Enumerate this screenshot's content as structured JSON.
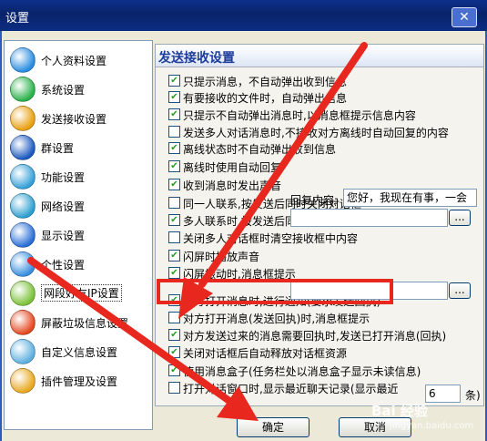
{
  "window": {
    "title": "设置",
    "close_glyph": "✕"
  },
  "sidebar": {
    "items": [
      {
        "label": "个人资料设置",
        "icon": "globe-icon",
        "color": "#2a8de0"
      },
      {
        "label": "系统设置",
        "icon": "gear-icon",
        "color": "#2bb24a"
      },
      {
        "label": "发送接收设置",
        "icon": "send-receive-icon",
        "color": "#e8a010"
      },
      {
        "label": "群设置",
        "icon": "group-icon",
        "color": "#1d5ac0"
      },
      {
        "label": "功能设置",
        "icon": "function-icon",
        "color": "#36a0d8"
      },
      {
        "label": "网络设置",
        "icon": "network-icon",
        "color": "#2f9fd0"
      },
      {
        "label": "显示设置",
        "icon": "display-icon",
        "color": "#2b6fd6"
      },
      {
        "label": "个性设置",
        "icon": "personalize-icon",
        "color": "#3a8fe0"
      },
      {
        "label": "网段好友IP设置",
        "icon": "ip-icon",
        "color": "#7cc23a"
      },
      {
        "label": "屏蔽垃圾信息设置",
        "icon": "block-spam-icon",
        "color": "#e44a22"
      },
      {
        "label": "自定义信息设置",
        "icon": "custom-info-icon",
        "color": "#5fb0e0"
      },
      {
        "label": "插件管理及设置",
        "icon": "plugin-icon",
        "color": "#e8a820"
      }
    ],
    "selected_index": 8
  },
  "panel": {
    "title": "发送接收设置",
    "options": [
      {
        "label": "只提示消息，不自动弹出收到信息",
        "checked": true
      },
      {
        "label": "有要接收的文件时，自动弹出信息",
        "checked": true
      },
      {
        "label": "只提示不自动弹出消息时,以消息框提示信息内容",
        "checked": true
      },
      {
        "label": "发送多人对话消息时,不接收对方离线时自动回复的内容",
        "checked": false
      },
      {
        "label": "离线状态时不自动弹出收到信息",
        "checked": true
      },
      {
        "label": "离线时使用自动回复",
        "checked": true
      },
      {
        "label": "收到消息时发出声音",
        "checked": true
      },
      {
        "label": "同一人联系,按发送后同时关闭对话框",
        "checked": false
      },
      {
        "label": "多人联系时,按发送后同时关闭对话框",
        "checked": true
      },
      {
        "label": "关闭多人对话框时清空接收框中内容",
        "checked": false
      },
      {
        "label": "闪屏时播放声音",
        "checked": true
      },
      {
        "label": "闪屏振动时,消息框提示",
        "checked": true
      },
      {
        "label": "对方打开消息时,进行通知(要求发送回执)",
        "checked": true
      },
      {
        "label": "对方打开消息(发送回执)时,消息框提示",
        "checked": false
      },
      {
        "label": "对方发送过来的消息需要回执时,发送已打开消息(回执)",
        "checked": true
      },
      {
        "label": "关闭对话框后自动释放对话框资源",
        "checked": true
      },
      {
        "label": "使用消息盒子(任务栏处以消息盒子显示未读信息)",
        "checked": true
      },
      {
        "label": "打开对话窗口时,显示最近聊天记录(显示最近",
        "checked": false
      }
    ],
    "reply_label": "回复内容:",
    "reply_value": "您好，我现在有事，一会",
    "history_count": "6",
    "history_unit": "条)",
    "browse_label": "..."
  },
  "buttons": {
    "ok": "确定",
    "cancel": "取消"
  },
  "watermark": {
    "brand": "Bai 经验",
    "url": "jingyan.baidu.com"
  },
  "colors": {
    "highlight": "#e8281e",
    "arrow": "#e8281e",
    "title": "#1d3c9b"
  }
}
